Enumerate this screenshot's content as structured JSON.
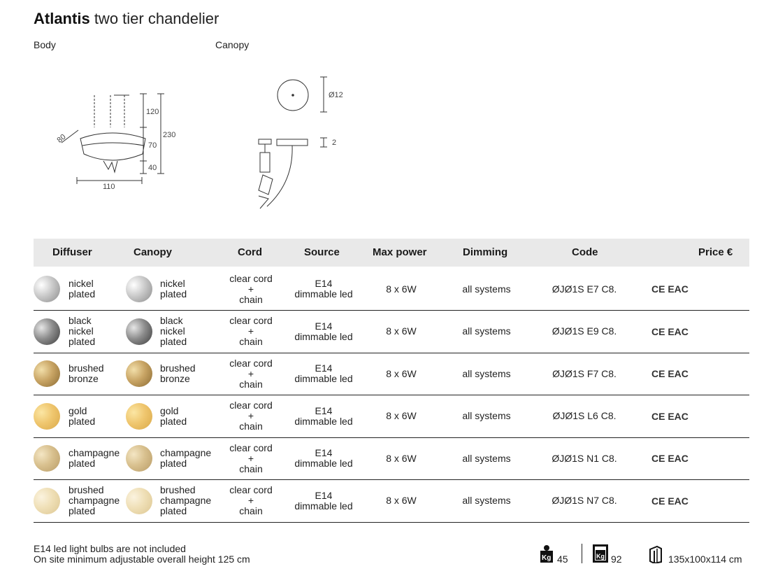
{
  "title": {
    "bold": "Atlantis",
    "rest": "two tier chandelier"
  },
  "drawing_labels": {
    "body": "Body",
    "canopy": "Canopy"
  },
  "body_dims": {
    "d1": "120",
    "d2": "70",
    "d3": "40",
    "total": "230",
    "width": "110",
    "depth": "80"
  },
  "canopy_dims": {
    "diameter": "Ø12",
    "height": "2"
  },
  "table": {
    "headers": {
      "diffuser": "Diffuser",
      "canopy": "Canopy",
      "cord": "Cord",
      "source": "Source",
      "max_power": "Max power",
      "dimming": "Dimming",
      "code": "Code",
      "price": "Price €"
    },
    "rows": [
      {
        "diffuser": "nickel\nplated",
        "canopy": "nickel\nplated",
        "cord": "clear cord\n+\nchain",
        "source": "E14\ndimmable led",
        "max_power": "8 x 6W",
        "dimming": "all systems",
        "code": "ØJØ1S E7 C8.",
        "cert": "CE EAC",
        "swatch": "nickel"
      },
      {
        "diffuser": "black\nnickel\nplated",
        "canopy": "black\nnickel\nplated",
        "cord": "clear cord\n+\nchain",
        "source": "E14\ndimmable led",
        "max_power": "8 x 6W",
        "dimming": "all systems",
        "code": "ØJØ1S E9 C8.",
        "cert": "CE EAC",
        "swatch": "blacknickel"
      },
      {
        "diffuser": "brushed\nbronze",
        "canopy": "brushed\nbronze",
        "cord": "clear cord\n+\nchain",
        "source": "E14\ndimmable led",
        "max_power": "8 x 6W",
        "dimming": "all systems",
        "code": "ØJØ1S F7 C8.",
        "cert": "CE EAC",
        "swatch": "bronze"
      },
      {
        "diffuser": "gold\nplated",
        "canopy": "gold\nplated",
        "cord": "clear cord\n+\nchain",
        "source": "E14\ndimmable led",
        "max_power": "8 x 6W",
        "dimming": "all systems",
        "code": "ØJØ1S L6 C8.",
        "cert": "CE EAC",
        "swatch": "gold"
      },
      {
        "diffuser": "champagne\nplated",
        "canopy": "champagne\nplated",
        "cord": "clear cord\n+\nchain",
        "source": "E14\ndimmable led",
        "max_power": "8 x 6W",
        "dimming": "all systems",
        "code": "ØJØ1S N1 C8.",
        "cert": "CE EAC",
        "swatch": "champagne"
      },
      {
        "diffuser": "brushed\nchampagne\nplated",
        "canopy": "brushed\nchampagne\nplated",
        "cord": "clear cord\n+\nchain",
        "source": "E14\ndimmable led",
        "max_power": "8 x 6W",
        "dimming": "all systems",
        "code": "ØJØ1S N7 C8.",
        "cert": "CE EAC",
        "swatch": "brushedchampagne"
      }
    ]
  },
  "footer": {
    "note1": "E14 led light bulbs are not included",
    "note2": "On site minimum adjustable overall height 125 cm",
    "net_weight": "45",
    "gross_weight": "92",
    "package_size": "135x100x114 cm"
  },
  "swatch_colors": {
    "nickel": [
      "#ffffff",
      "#c9c9c9",
      "#8a8a8a"
    ],
    "blacknickel": [
      "#e6e6e6",
      "#8c8c8c",
      "#3c3c3c"
    ],
    "bronze": [
      "#f2dfaa",
      "#c8a464",
      "#8a6a32"
    ],
    "gold": [
      "#fbe6a4",
      "#efc66e",
      "#d9a848"
    ],
    "champagne": [
      "#f4e6c4",
      "#d8c08e",
      "#b89b66"
    ],
    "brushedchampagne": [
      "#fbf3df",
      "#efdfb6",
      "#dcc691"
    ]
  }
}
